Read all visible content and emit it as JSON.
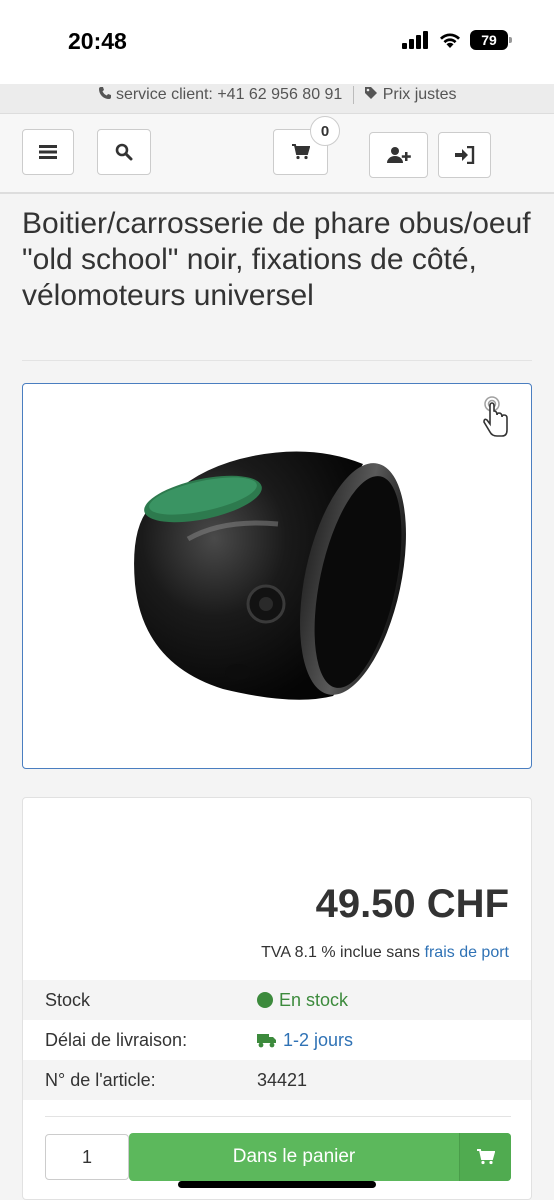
{
  "status": {
    "time": "20:48",
    "battery": "79"
  },
  "infobar": {
    "phone": "service client: +41 62 956 80 91",
    "fair": "Prix justes"
  },
  "nav": {
    "cart_count": "0"
  },
  "product": {
    "title": "Boitier/carrosserie de phare obus/oeuf \"old school\" noir, fixations de côté, vélomoteurs universel",
    "price": "49.50 CHF",
    "vat_text": "TVA 8.1 % inclue sans",
    "shipping_link": "frais de port",
    "details": [
      {
        "label": "Stock",
        "value": "En stock"
      },
      {
        "label": "Délai de livraison:",
        "value": "1-2 jours"
      },
      {
        "label": "N° de l'article:",
        "value": "34421"
      }
    ],
    "quantity": "1",
    "add_to_cart": "Dans le panier"
  },
  "colors": {
    "accent_green": "#5cb85c",
    "link_blue": "#2f72b5",
    "stock_green": "#3c8a3c"
  },
  "icons": [
    "menu-icon",
    "search-icon",
    "cart-icon",
    "user-plus-icon",
    "sign-in-icon",
    "phone-icon",
    "tag-icon",
    "pointer-hand-icon",
    "truck-icon"
  ]
}
